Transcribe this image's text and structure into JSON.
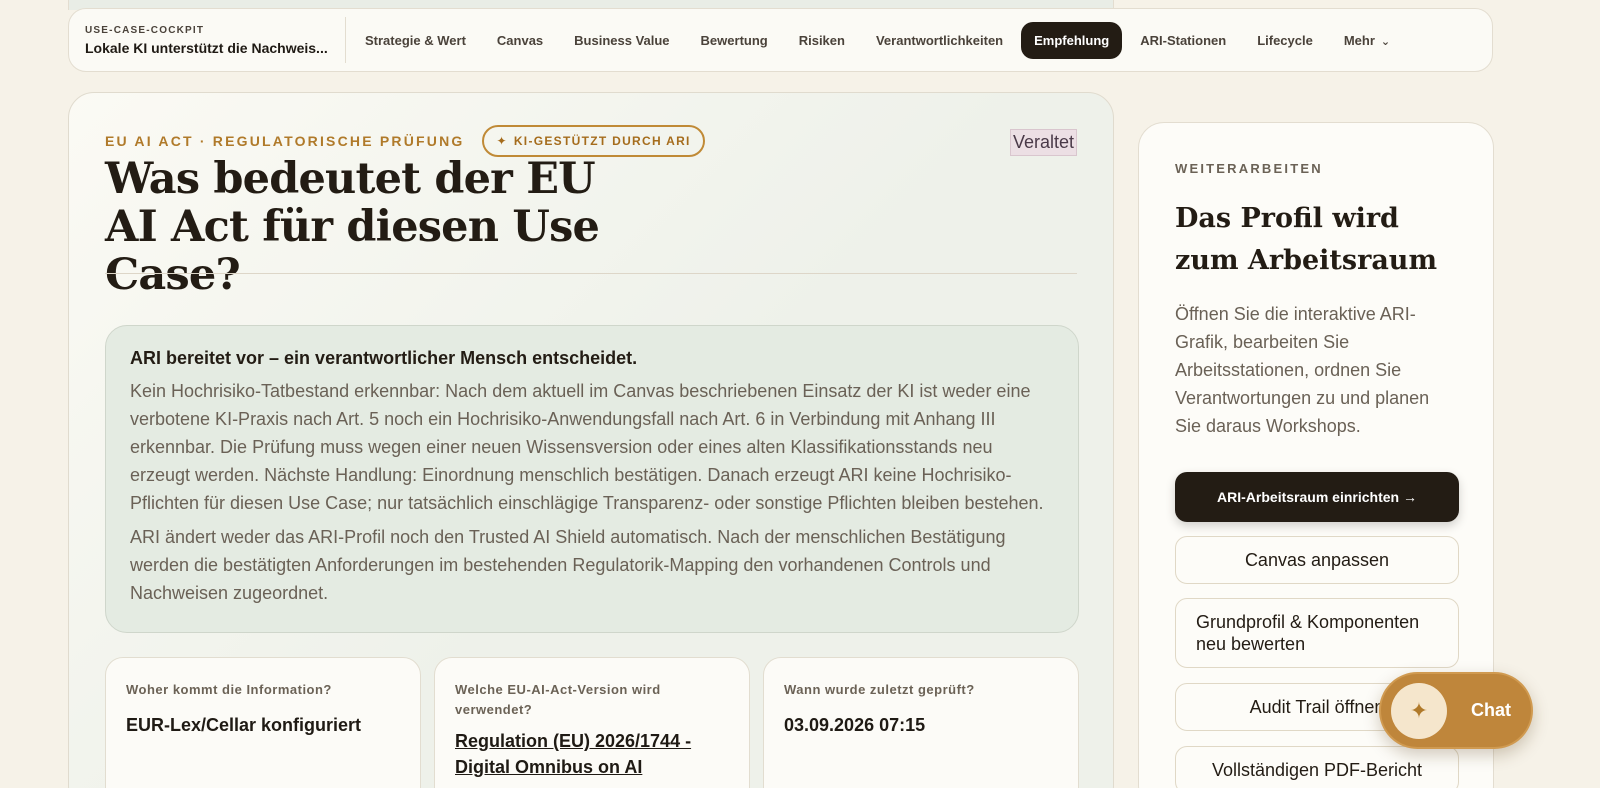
{
  "nav": {
    "kicker": "USE-CASE-COCKPIT",
    "title": "Lokale KI unterstützt die Nachweis...",
    "items": [
      {
        "label": "Strategie & Wert"
      },
      {
        "label": "Canvas"
      },
      {
        "label": "Business Value"
      },
      {
        "label": "Bewertung"
      },
      {
        "label": "Risiken"
      },
      {
        "label": "Verantwortlichkeiten"
      },
      {
        "label": "Empfehlung",
        "active": true
      },
      {
        "label": "ARI-Stationen"
      },
      {
        "label": "Lifecycle"
      },
      {
        "label": "Mehr"
      }
    ],
    "more_icon": "chevron-down-icon"
  },
  "main": {
    "kicker": "EU AI ACT · REGULATORISCHE PRÜFUNG",
    "badge": "KI-GESTÜTZT DURCH ARI",
    "badge_icon": "sparkle-icon",
    "status": "Veraltet",
    "title": "Was bedeutet der EU AI Act für diesen Use Case?",
    "info": {
      "lead": "ARI bereitet vor – ein verantwortlicher Mensch entscheidet.",
      "paragraph1": "Kein Hochrisiko-Tatbestand erkennbar: Nach dem aktuell im Canvas beschriebenen Einsatz der KI ist weder eine verbotene KI-Praxis nach Art. 5 noch ein Hochrisiko-Anwendungsfall nach Art. 6 in Verbindung mit Anhang III erkennbar. Die Prüfung muss wegen einer neuen Wissensversion oder eines alten Klassifikationsstands neu erzeugt werden. Nächste Handlung: Einordnung menschlich bestätigen. Danach erzeugt ARI keine Hochrisiko-Pflichten für diesen Use Case; nur tatsächlich einschlägige Transparenz- oder sonstige Pflichten bleiben bestehen.",
      "paragraph2": "ARI ändert weder das ARI-Profil noch den Trusted AI Shield automatisch. Nach der menschlichen Bestätigung werden die bestätigten Anforderungen im bestehenden Regulatorik-Mapping den vorhandenen Controls und Nachweisen zugeordnet."
    },
    "facts": [
      {
        "label": "Woher kommt die Information?",
        "value": "EUR-Lex/Cellar konfiguriert"
      },
      {
        "label": "Welche EU-AI-Act-Version wird verwendet?",
        "value": "Regulation (EU) 2026/1744 - Digital Omnibus on AI"
      },
      {
        "label": "Wann wurde zuletzt geprüft?",
        "value": "03.09.2026 07:15"
      }
    ]
  },
  "sidebar": {
    "kicker": "WEITERARBEITEN",
    "title": "Das Profil wird zum Arbeitsraum",
    "text": "Öffnen Sie die interaktive ARI-Grafik, bearbeiten Sie Arbeitsstationen, ordnen Sie Verantwortungen zu und planen Sie daraus Workshops.",
    "primary": "ARI-Arbeitsraum einrichten →",
    "buttons": [
      "Canvas anpassen",
      "Grundprofil & Komponenten neu bewerten",
      "Audit Trail öffnen",
      "Vollständigen PDF-Bericht"
    ]
  },
  "chat": {
    "label": "Chat",
    "icon": "sparkle-icon"
  },
  "colors": {
    "accent": "#b07a2a",
    "dark": "#231c14",
    "background": "#f6f2e8"
  }
}
